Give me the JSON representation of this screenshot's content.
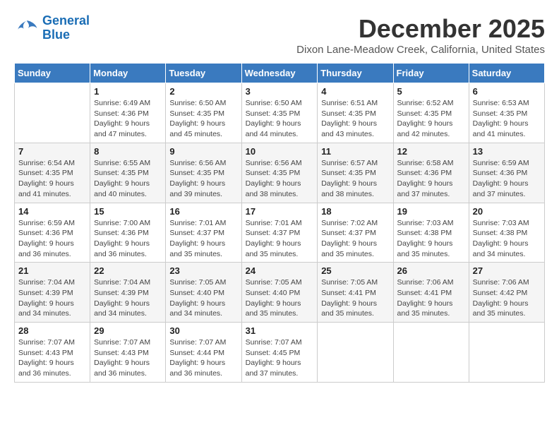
{
  "logo": {
    "line1": "General",
    "line2": "Blue"
  },
  "title": "December 2025",
  "location": "Dixon Lane-Meadow Creek, California, United States",
  "weekdays": [
    "Sunday",
    "Monday",
    "Tuesday",
    "Wednesday",
    "Thursday",
    "Friday",
    "Saturday"
  ],
  "weeks": [
    [
      {
        "day": "",
        "sunrise": "",
        "sunset": "",
        "daylight": ""
      },
      {
        "day": "1",
        "sunrise": "Sunrise: 6:49 AM",
        "sunset": "Sunset: 4:36 PM",
        "daylight": "Daylight: 9 hours and 47 minutes."
      },
      {
        "day": "2",
        "sunrise": "Sunrise: 6:50 AM",
        "sunset": "Sunset: 4:35 PM",
        "daylight": "Daylight: 9 hours and 45 minutes."
      },
      {
        "day": "3",
        "sunrise": "Sunrise: 6:50 AM",
        "sunset": "Sunset: 4:35 PM",
        "daylight": "Daylight: 9 hours and 44 minutes."
      },
      {
        "day": "4",
        "sunrise": "Sunrise: 6:51 AM",
        "sunset": "Sunset: 4:35 PM",
        "daylight": "Daylight: 9 hours and 43 minutes."
      },
      {
        "day": "5",
        "sunrise": "Sunrise: 6:52 AM",
        "sunset": "Sunset: 4:35 PM",
        "daylight": "Daylight: 9 hours and 42 minutes."
      },
      {
        "day": "6",
        "sunrise": "Sunrise: 6:53 AM",
        "sunset": "Sunset: 4:35 PM",
        "daylight": "Daylight: 9 hours and 41 minutes."
      }
    ],
    [
      {
        "day": "7",
        "sunrise": "Sunrise: 6:54 AM",
        "sunset": "Sunset: 4:35 PM",
        "daylight": "Daylight: 9 hours and 41 minutes."
      },
      {
        "day": "8",
        "sunrise": "Sunrise: 6:55 AM",
        "sunset": "Sunset: 4:35 PM",
        "daylight": "Daylight: 9 hours and 40 minutes."
      },
      {
        "day": "9",
        "sunrise": "Sunrise: 6:56 AM",
        "sunset": "Sunset: 4:35 PM",
        "daylight": "Daylight: 9 hours and 39 minutes."
      },
      {
        "day": "10",
        "sunrise": "Sunrise: 6:56 AM",
        "sunset": "Sunset: 4:35 PM",
        "daylight": "Daylight: 9 hours and 38 minutes."
      },
      {
        "day": "11",
        "sunrise": "Sunrise: 6:57 AM",
        "sunset": "Sunset: 4:35 PM",
        "daylight": "Daylight: 9 hours and 38 minutes."
      },
      {
        "day": "12",
        "sunrise": "Sunrise: 6:58 AM",
        "sunset": "Sunset: 4:36 PM",
        "daylight": "Daylight: 9 hours and 37 minutes."
      },
      {
        "day": "13",
        "sunrise": "Sunrise: 6:59 AM",
        "sunset": "Sunset: 4:36 PM",
        "daylight": "Daylight: 9 hours and 37 minutes."
      }
    ],
    [
      {
        "day": "14",
        "sunrise": "Sunrise: 6:59 AM",
        "sunset": "Sunset: 4:36 PM",
        "daylight": "Daylight: 9 hours and 36 minutes."
      },
      {
        "day": "15",
        "sunrise": "Sunrise: 7:00 AM",
        "sunset": "Sunset: 4:36 PM",
        "daylight": "Daylight: 9 hours and 36 minutes."
      },
      {
        "day": "16",
        "sunrise": "Sunrise: 7:01 AM",
        "sunset": "Sunset: 4:37 PM",
        "daylight": "Daylight: 9 hours and 35 minutes."
      },
      {
        "day": "17",
        "sunrise": "Sunrise: 7:01 AM",
        "sunset": "Sunset: 4:37 PM",
        "daylight": "Daylight: 9 hours and 35 minutes."
      },
      {
        "day": "18",
        "sunrise": "Sunrise: 7:02 AM",
        "sunset": "Sunset: 4:37 PM",
        "daylight": "Daylight: 9 hours and 35 minutes."
      },
      {
        "day": "19",
        "sunrise": "Sunrise: 7:03 AM",
        "sunset": "Sunset: 4:38 PM",
        "daylight": "Daylight: 9 hours and 35 minutes."
      },
      {
        "day": "20",
        "sunrise": "Sunrise: 7:03 AM",
        "sunset": "Sunset: 4:38 PM",
        "daylight": "Daylight: 9 hours and 34 minutes."
      }
    ],
    [
      {
        "day": "21",
        "sunrise": "Sunrise: 7:04 AM",
        "sunset": "Sunset: 4:39 PM",
        "daylight": "Daylight: 9 hours and 34 minutes."
      },
      {
        "day": "22",
        "sunrise": "Sunrise: 7:04 AM",
        "sunset": "Sunset: 4:39 PM",
        "daylight": "Daylight: 9 hours and 34 minutes."
      },
      {
        "day": "23",
        "sunrise": "Sunrise: 7:05 AM",
        "sunset": "Sunset: 4:40 PM",
        "daylight": "Daylight: 9 hours and 34 minutes."
      },
      {
        "day": "24",
        "sunrise": "Sunrise: 7:05 AM",
        "sunset": "Sunset: 4:40 PM",
        "daylight": "Daylight: 9 hours and 35 minutes."
      },
      {
        "day": "25",
        "sunrise": "Sunrise: 7:05 AM",
        "sunset": "Sunset: 4:41 PM",
        "daylight": "Daylight: 9 hours and 35 minutes."
      },
      {
        "day": "26",
        "sunrise": "Sunrise: 7:06 AM",
        "sunset": "Sunset: 4:41 PM",
        "daylight": "Daylight: 9 hours and 35 minutes."
      },
      {
        "day": "27",
        "sunrise": "Sunrise: 7:06 AM",
        "sunset": "Sunset: 4:42 PM",
        "daylight": "Daylight: 9 hours and 35 minutes."
      }
    ],
    [
      {
        "day": "28",
        "sunrise": "Sunrise: 7:07 AM",
        "sunset": "Sunset: 4:43 PM",
        "daylight": "Daylight: 9 hours and 36 minutes."
      },
      {
        "day": "29",
        "sunrise": "Sunrise: 7:07 AM",
        "sunset": "Sunset: 4:43 PM",
        "daylight": "Daylight: 9 hours and 36 minutes."
      },
      {
        "day": "30",
        "sunrise": "Sunrise: 7:07 AM",
        "sunset": "Sunset: 4:44 PM",
        "daylight": "Daylight: 9 hours and 36 minutes."
      },
      {
        "day": "31",
        "sunrise": "Sunrise: 7:07 AM",
        "sunset": "Sunset: 4:45 PM",
        "daylight": "Daylight: 9 hours and 37 minutes."
      },
      {
        "day": "",
        "sunrise": "",
        "sunset": "",
        "daylight": ""
      },
      {
        "day": "",
        "sunrise": "",
        "sunset": "",
        "daylight": ""
      },
      {
        "day": "",
        "sunrise": "",
        "sunset": "",
        "daylight": ""
      }
    ]
  ]
}
